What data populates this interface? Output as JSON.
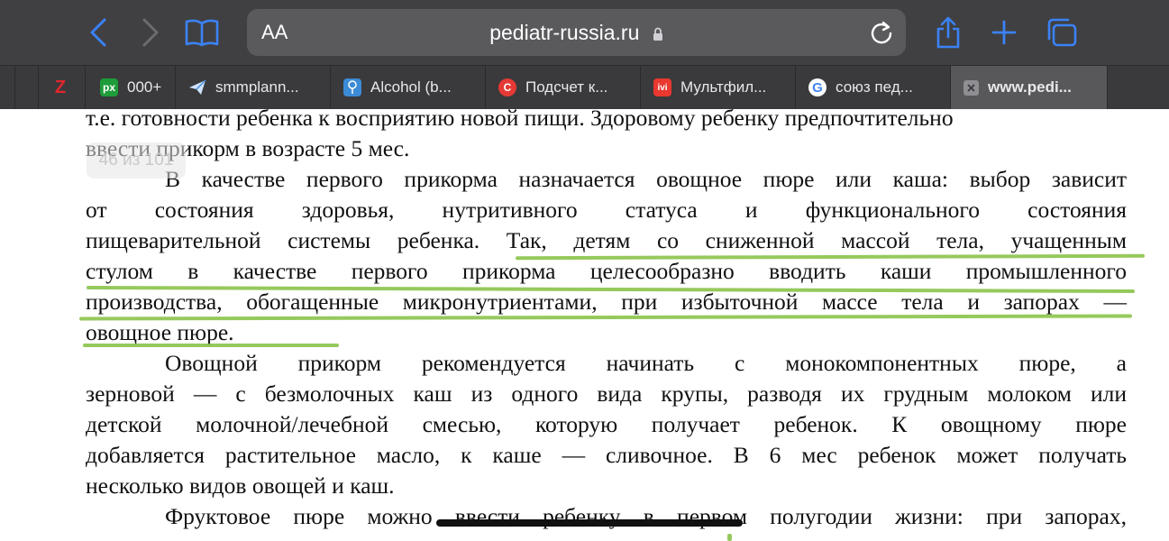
{
  "browser": {
    "address_bar": {
      "text_size_label": "AA",
      "url": "pediatr-russia.ru"
    },
    "tabs": [
      {
        "label": "",
        "icon": "z-icon",
        "color": "#e0262b"
      },
      {
        "label": "000+",
        "icon": "px-icon",
        "color": "#1e9c3a"
      },
      {
        "label": "smmplann...",
        "icon": "paper-plane-icon",
        "color": "#4a90d9"
      },
      {
        "label": "Alcohol (b...",
        "icon": "pin-icon",
        "color": "#3b8bd6"
      },
      {
        "label": "Подсчет к...",
        "icon": "c-icon",
        "color": "#e53935"
      },
      {
        "label": "Мультфил...",
        "icon": "ivi-icon",
        "color": "#e8382f"
      },
      {
        "label": "союз пед...",
        "icon": "google-icon",
        "color": "#ffffff"
      },
      {
        "label": "www.pedi...",
        "icon": "close-icon",
        "color": "#8e8e93"
      }
    ],
    "ghost_overlay": "46 из 101"
  },
  "document": {
    "lines": [
      "т.е. готовности ребенка к восприятию новой пищи. Здоровому ребенку предпочтительно",
      "ввести прикорм в возрасте 5 мес.",
      "В качестве первого прикорма назначается овощное пюре или каша: выбор зависит",
      "от состояния здоровья, нутритивного статуса и функционального состояния",
      "пищеварительной системы ребенка. Так, детям со сниженной массой тела, учащенным",
      "стулом в качестве первого прикорма целесообразно вводить каши промышленного",
      "производства, обогащенные микронутриентами, при избыточной массе тела и запорах —",
      "овощное пюре.",
      "Овощной прикорм рекомендуется начинать с монокомпонентных пюре, а",
      "зерновой — с безмолочных каш из одного вида крупы, разводя их грудным молоком или",
      "детской молочной/лечебной смесью, которую получает ребенок. К овощному пюре",
      "добавляется растительное масло, к каше — сливочное. В 6 мес ребенок может получать",
      "несколько видов овощей и каш.",
      "Фруктовое пюре можно ввести ребенку в первом полугодии жизни: при запорах,"
    ],
    "highlight_color": "#8bc34a"
  }
}
